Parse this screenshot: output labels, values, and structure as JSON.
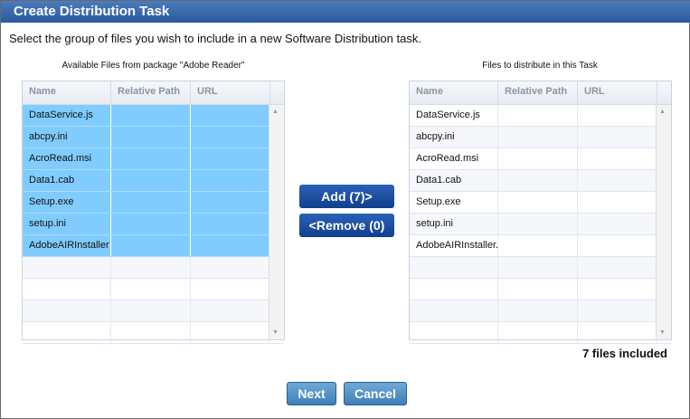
{
  "title": "Create Distribution Task",
  "instruction": "Select the group of files you wish to include in a new Software Distribution task.",
  "left": {
    "caption": "Available Files from package \"Adobe Reader\"",
    "columns": [
      "Name",
      "Relative Path",
      "URL"
    ],
    "rows": [
      "DataService.js",
      "abcpy.ini",
      "AcroRead.msi",
      "Data1.cab",
      "Setup.exe",
      "setup.ini",
      "AdobeAIRInstaller"
    ]
  },
  "right": {
    "caption": "Files to distribute in this Task",
    "columns": [
      "Name",
      "Relative Path",
      "URL"
    ],
    "rows": [
      "DataService.js",
      "abcpy.ini",
      "AcroRead.msi",
      "Data1.cab",
      "Setup.exe",
      "setup.ini",
      "AdobeAIRInstaller."
    ]
  },
  "add_label": "Add (7)>",
  "remove_label": "<Remove (0)",
  "status": "7 files included",
  "next_label": "Next",
  "cancel_label": "Cancel"
}
